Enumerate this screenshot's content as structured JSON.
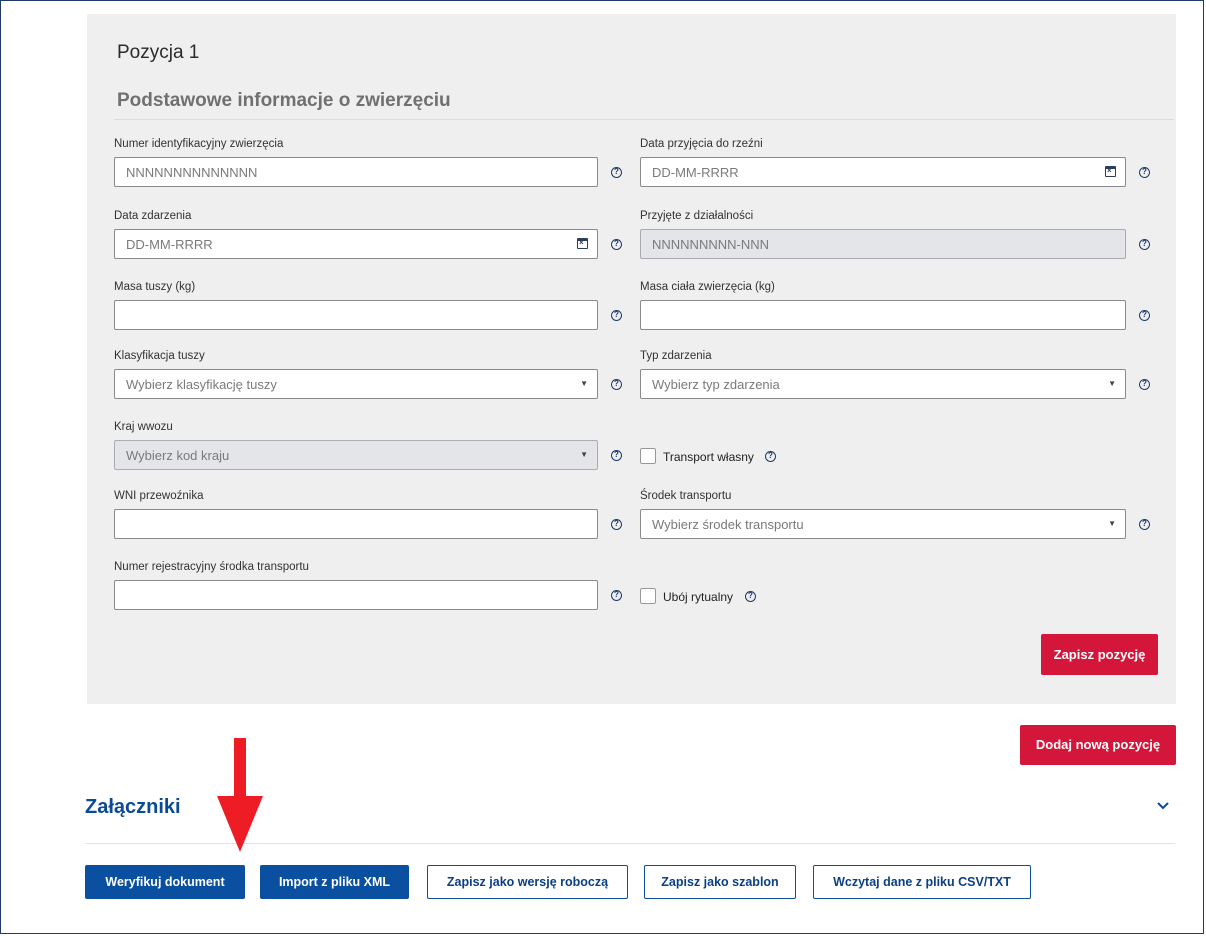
{
  "position": {
    "title": "Pozycja 1",
    "section_title": "Podstawowe informacje o zwierzęciu"
  },
  "fields": {
    "animal_id": {
      "label": "Numer identyfikacyjny zwierzęcia",
      "placeholder": "NNNNNNNNNNNNNN"
    },
    "slaughter_date": {
      "label": "Data przyjęcia do rzeźni",
      "placeholder": "DD-MM-RRRR"
    },
    "event_date": {
      "label": "Data zdarzenia",
      "placeholder": "DD-MM-RRRR"
    },
    "accepted_from": {
      "label": "Przyjęte z działalności",
      "placeholder": "NNNNNNNNN-NNN"
    },
    "carcass_mass": {
      "label": "Masa tuszy (kg)",
      "value": ""
    },
    "body_mass": {
      "label": "Masa ciała zwierzęcia (kg)",
      "value": ""
    },
    "carcass_class": {
      "label": "Klasyfikacja tuszy",
      "placeholder": "Wybierz klasyfikację tuszy"
    },
    "event_type": {
      "label": "Typ zdarzenia",
      "placeholder": "Wybierz typ zdarzenia"
    },
    "import_country": {
      "label": "Kraj wwozu",
      "placeholder": "Wybierz kod kraju"
    },
    "own_transport": {
      "label": "Transport własny"
    },
    "carrier_wni": {
      "label": "WNI przewoźnika",
      "value": ""
    },
    "transport_means": {
      "label": "Środek transportu",
      "placeholder": "Wybierz środek transportu"
    },
    "registration": {
      "label": "Numer rejestracyjny środka transportu",
      "value": ""
    },
    "ritual_slaughter": {
      "label": "Ubój rytualny"
    }
  },
  "buttons": {
    "save_position": "Zapisz pozycję",
    "add_position": "Dodaj nową pozycję",
    "verify": "Weryfikuj dokument",
    "import_xml": "Import z pliku XML",
    "save_draft": "Zapisz jako wersję roboczą",
    "save_template": "Zapisz jako szablon",
    "load_csv": "Wczytaj dane z pliku CSV/TXT"
  },
  "attachments": {
    "title": "Załączniki"
  },
  "colors": {
    "primary": "#0a4fa0",
    "danger": "#d4163b",
    "arrow": "#ee1c24"
  },
  "icons": {
    "help": "question-circle-icon",
    "calendar": "calendar-icon",
    "dropdown": "caret-down-icon",
    "expand": "chevron-down-icon"
  }
}
